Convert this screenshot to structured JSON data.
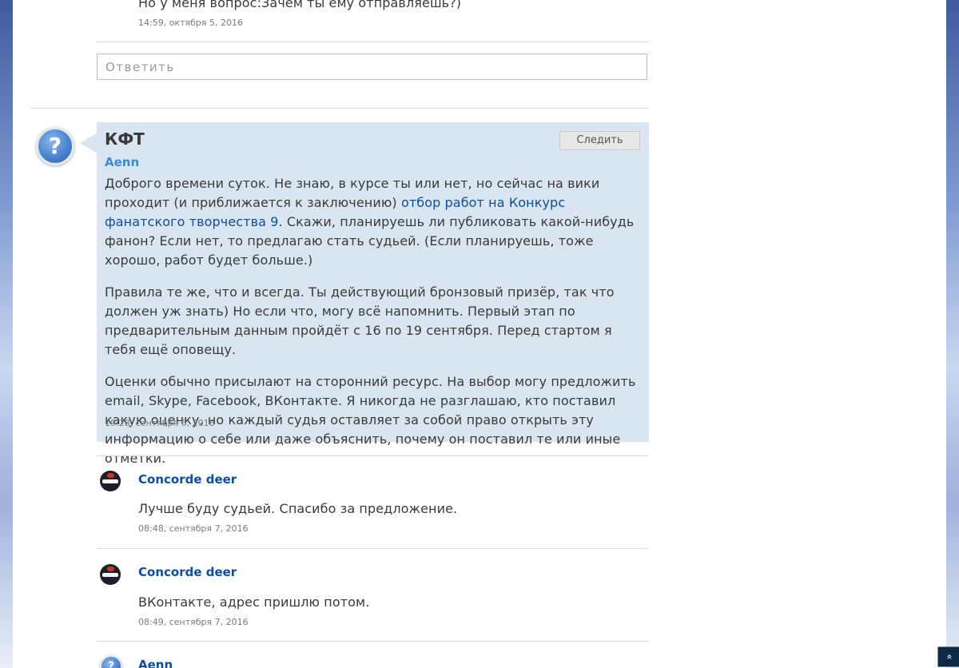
{
  "top_comment": {
    "text_partial": "Но у меня вопрос:Зачем ты ему отправляешь?)",
    "timestamp": "14:59, октября 5, 2016"
  },
  "reply_box": {
    "placeholder": "Ответить"
  },
  "thread": {
    "title": "КФТ",
    "follow_button": "Следить",
    "author": "Aenn",
    "paragraphs": [
      {
        "before_link": "Доброго времени суток. Не знаю, в курсе ты или нет, но сейчас на вики проходит (и приближается к заключению) ",
        "link_text": "отбор работ на Конкурс фанатского творчества 9",
        "after_link": ". Скажи, планируешь ли публиковать какой-нибудь фанон? Если нет, то предлагаю стать судьей. (Если планируешь, тоже хорошо, работ будет больше.)"
      },
      {
        "text": "Правила те же, что и всегда. Ты действующий бронзовый призёр, так что должен уж знать) Но если что, могу всё напомнить. Первый этап по предварительным данным пройдёт с 16 по 19 сентября. Перед стартом я тебя ещё оповещу."
      },
      {
        "text": "Оценки обычно присылают на сторонний ресурс. На выбор могу предложить email, Skype, Facebook, ВКонтакте. Я никогда не разглашаю, кто поставил какую оценку, но каждый судья оставляет за собой право открыть эту информацию о себе или даже объяснить, почему он поставил те или иные отметки."
      }
    ],
    "timestamp": "19:28, сентября 6, 2016"
  },
  "replies": [
    {
      "author": "Concorde deer",
      "text": "Лучше буду судьей. Спасибо за предложение.",
      "timestamp": "08:48, сентября 7, 2016"
    },
    {
      "author": "Concorde deer",
      "text": "ВКонтакте, адрес пришлю потом.",
      "timestamp": "08:49, сентября 7, 2016"
    },
    {
      "author": "Aenn"
    }
  ],
  "icons": {
    "question_avatar": "question-mark-icon",
    "scroll_top": "chevron-double-up-icon"
  },
  "colors": {
    "bubble_bg": "#d9e6f2",
    "link": "#0b4ea2",
    "scroll_btn": "#0c2a45"
  }
}
